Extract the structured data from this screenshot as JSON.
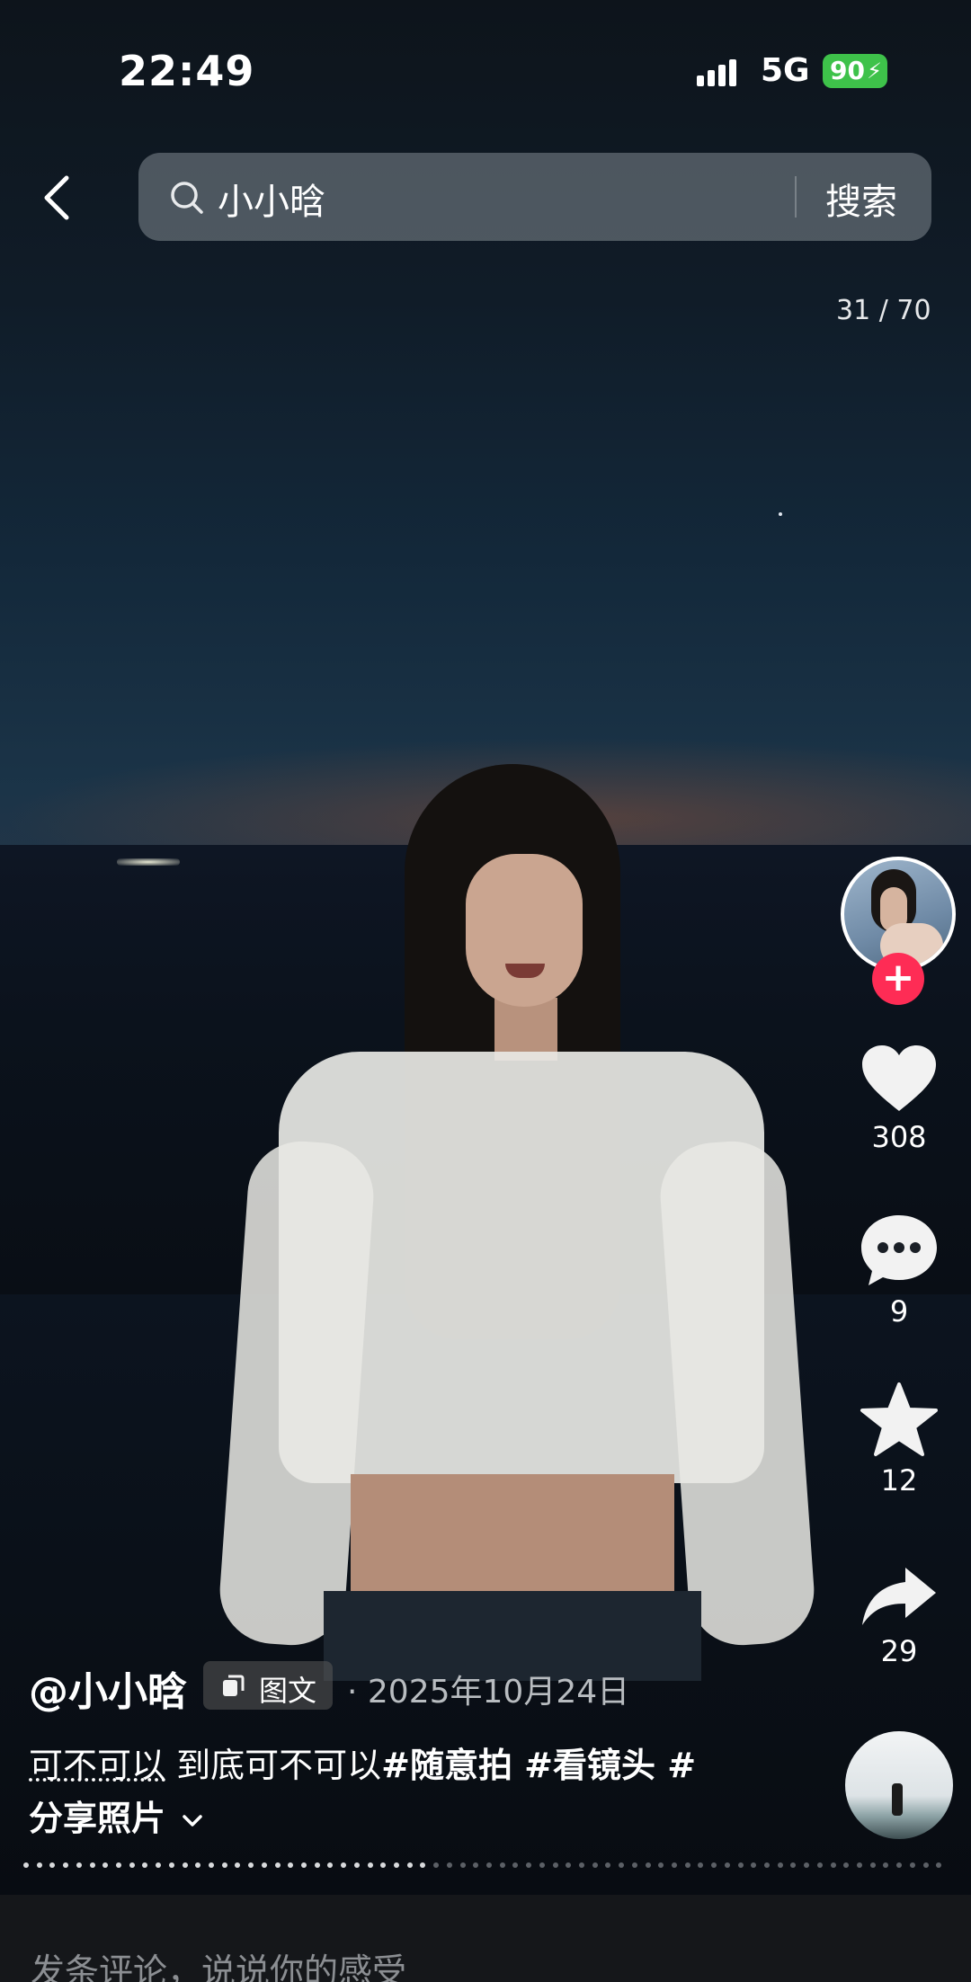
{
  "status_bar": {
    "time": "22:49",
    "network": "5G",
    "battery": "90"
  },
  "search": {
    "query": "小小晗",
    "button_label": "搜索"
  },
  "gallery": {
    "counter": "31 / 70",
    "position": 31,
    "total": 70
  },
  "rail": {
    "likes": "308",
    "comments": "9",
    "favorites": "12",
    "shares": "29"
  },
  "post": {
    "author": "@小小晗",
    "type_tag": "图文",
    "date": "· 2025年10月24日",
    "title": "可不可以",
    "text": " 到底可不可以",
    "hashtags": "#随意拍 #看镜头 #",
    "line2": "分享照片",
    "expand_icon": "chevron-down"
  },
  "comment": {
    "placeholder": "发条评论，说说你的感受"
  },
  "colors": {
    "follow_accent": "#fe2c55",
    "battery_green": "#3ec24a"
  }
}
